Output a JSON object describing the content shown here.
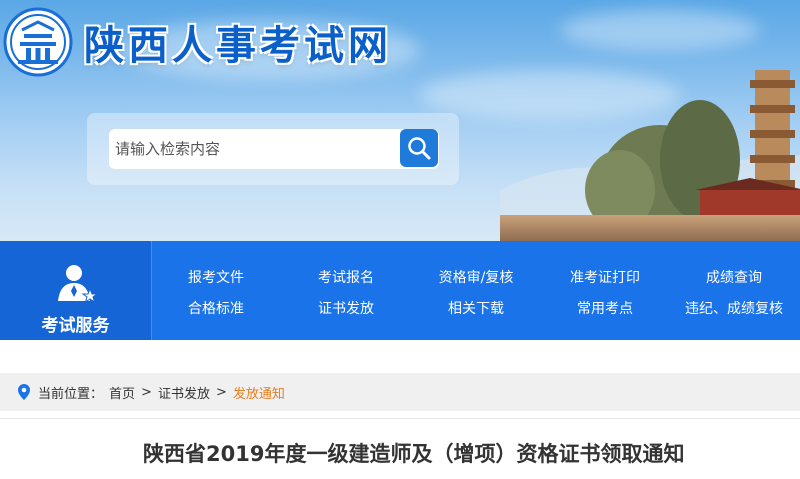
{
  "header": {
    "site_title": "陕西人事考试网",
    "logo_icon": "mountain-gate-logo"
  },
  "search": {
    "placeholder": "请输入检索内容",
    "button_icon": "search-icon"
  },
  "nav": {
    "service_label": "考试服务",
    "service_icon": "person-star-icon",
    "row1": [
      "报考文件",
      "考试报名",
      "资格审/复核",
      "准考证打印",
      "成绩查询"
    ],
    "row2": [
      "合格标准",
      "证书发放",
      "相关下载",
      "常用考点",
      "违纪、成绩复核"
    ]
  },
  "breadcrumb": {
    "location_icon": "location-pin-icon",
    "label": "当前位置：",
    "items": [
      "首页",
      "证书发放",
      "发放通知"
    ],
    "separator": ">"
  },
  "article": {
    "title": "陕西省2019年度一级建造师及（增项）资格证书领取通知"
  },
  "colors": {
    "brand_blue": "#1a73e8",
    "title_blue": "#0b5fc9",
    "current_orange": "#e67e22"
  }
}
